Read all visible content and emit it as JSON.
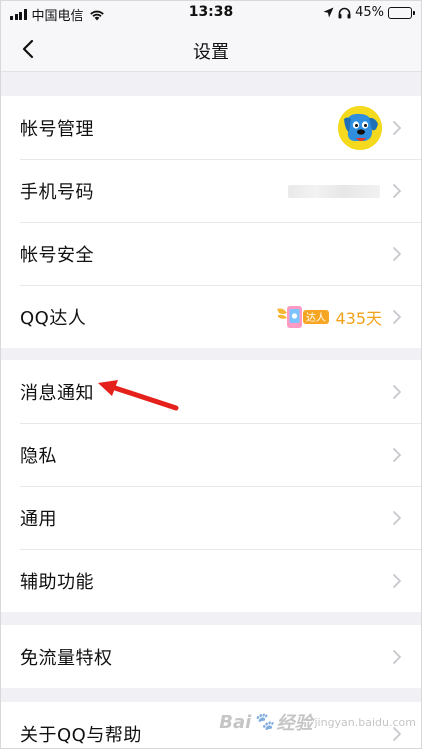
{
  "status_bar": {
    "carrier": "中国电信",
    "time": "13:38",
    "battery_percent": "45%",
    "battery_level": 0.45
  },
  "nav": {
    "title": "设置",
    "back_icon": "chevron-left-icon"
  },
  "groups": [
    {
      "items": [
        {
          "label": "帐号管理",
          "accessory": "avatar"
        },
        {
          "label": "手机号码",
          "accessory": "masked-value"
        },
        {
          "label": "帐号安全",
          "accessory": "none"
        },
        {
          "label": "QQ达人",
          "accessory": "daren",
          "badge_text": "达人",
          "days": "435天"
        }
      ]
    },
    {
      "items": [
        {
          "label": "消息通知"
        },
        {
          "label": "隐私"
        },
        {
          "label": "通用"
        },
        {
          "label": "辅助功能"
        }
      ]
    },
    {
      "items": [
        {
          "label": "免流量特权"
        }
      ]
    },
    {
      "items": [
        {
          "label": "关于QQ与帮助"
        }
      ]
    }
  ],
  "annotation": {
    "color": "#e5211b",
    "target": "消息通知"
  },
  "watermark": {
    "text": "Bai",
    "sub": "经验",
    "sub2": "jingyan.baidu.com"
  },
  "colors": {
    "accent_orange": "#f3a31b",
    "background": "#f1f1f5",
    "chevron": "#c7c7cc"
  }
}
